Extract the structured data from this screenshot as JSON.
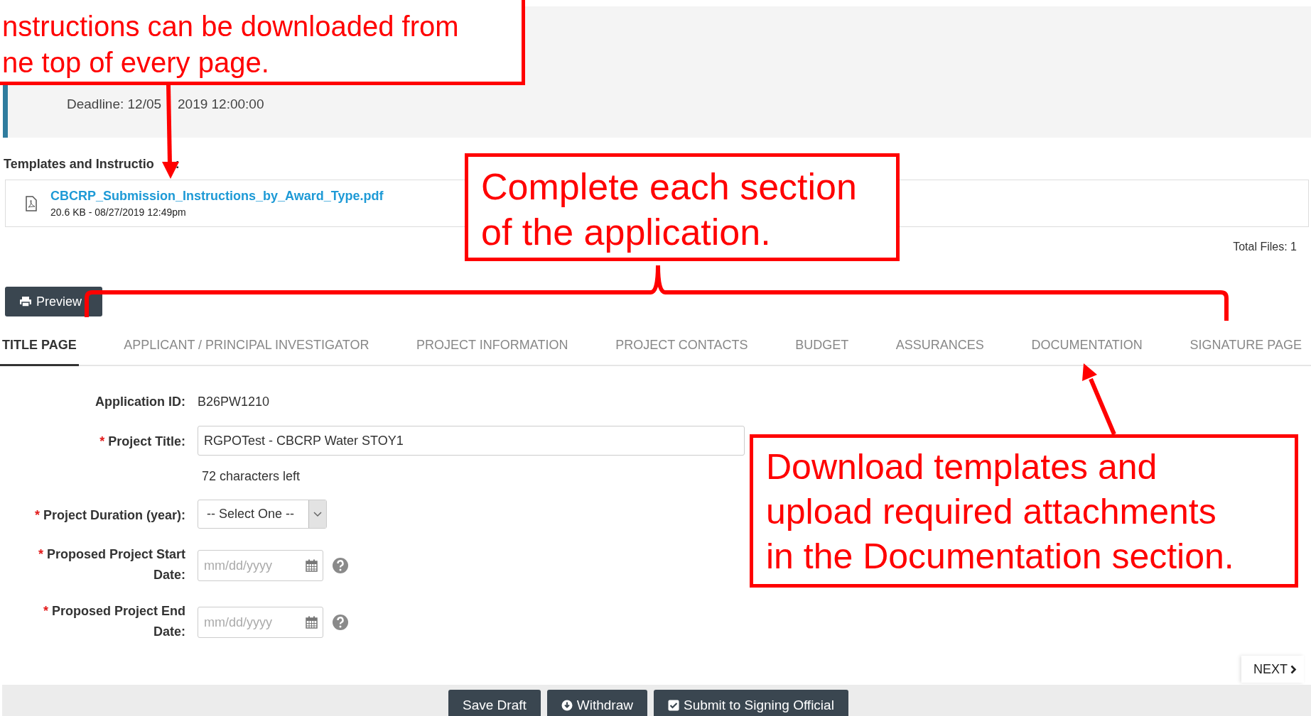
{
  "header": {
    "deadline": [
      "Deadline: 12/05",
      "2019 12:00:00"
    ]
  },
  "templates": {
    "heading": [
      "Templates and Instructio",
      ":"
    ],
    "files": [
      {
        "name": "CBCRP_Submission_Instructions_by_Award_Type.pdf",
        "meta": "20.6 KB - 08/27/2019 12:49pm"
      }
    ],
    "total": "Total Files: 1"
  },
  "preview_button": "Preview",
  "tabs": [
    {
      "label": "TITLE PAGE",
      "selected": true
    },
    {
      "label": "APPLICANT / PRINCIPAL INVESTIGATOR",
      "selected": false
    },
    {
      "label": "PROJECT INFORMATION",
      "selected": false
    },
    {
      "label": "PROJECT CONTACTS",
      "selected": false
    },
    {
      "label": "BUDGET",
      "selected": false
    },
    {
      "label": "ASSURANCES",
      "selected": false
    },
    {
      "label": "DOCUMENTATION",
      "selected": false
    },
    {
      "label": "SIGNATURE PAGE",
      "selected": false
    }
  ],
  "form": {
    "fields": [
      {
        "kind": "text",
        "label": "Application ID:",
        "value": "B26PW1210"
      },
      {
        "kind": "input",
        "mark": "*",
        "label": "Project Title:",
        "value": "RGPOTest - CBCRP Water STOY1",
        "hint": "72 characters left"
      },
      {
        "kind": "select",
        "mark": "*",
        "label": "Project Duration (year):",
        "value": "-- Select One --"
      },
      {
        "kind": "date",
        "mark": "*",
        "label": "Proposed Project Start Date:",
        "placeholder": "mm/dd/yyyy"
      },
      {
        "kind": "date",
        "mark": "*",
        "label": "Proposed Project End Date:",
        "placeholder": "mm/dd/yyyy"
      }
    ]
  },
  "next_button": "NEXT",
  "footer_buttons": [
    {
      "label": "Save Draft",
      "kind": "plain"
    },
    {
      "label": "Withdraw",
      "kind": "withdraw"
    },
    {
      "label": "Submit to Signing Official",
      "kind": "submit"
    }
  ],
  "annotations": [
    {
      "text": "nstructions can be downloaded from\nne top of every page."
    },
    {
      "text": "Complete each section\nof the application."
    },
    {
      "text": "Download templates and\nupload required attachments\nin the Documentation section."
    }
  ]
}
